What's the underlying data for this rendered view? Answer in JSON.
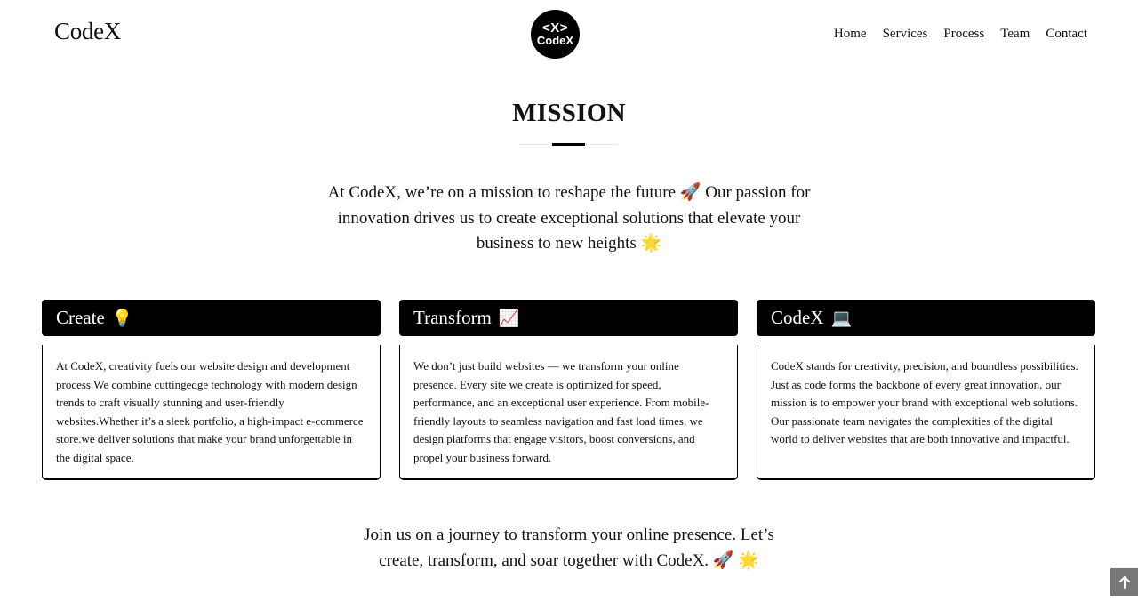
{
  "header": {
    "brand": "CodeX",
    "logo": {
      "glyph": "<X>",
      "word": "CodeX"
    },
    "nav": [
      {
        "label": "Home"
      },
      {
        "label": "Services"
      },
      {
        "label": "Process"
      },
      {
        "label": "Team"
      },
      {
        "label": "Contact"
      }
    ]
  },
  "mission": {
    "title": "MISSION",
    "intro": "At CodeX, we’re on a mission to reshape the future 🚀 Our passion for innovation drives us to create exceptional solutions that elevate your business to new heights 🌟"
  },
  "cards": [
    {
      "title": "Create",
      "emoji": "💡",
      "body": "At CodeX, creativity fuels our website design and development process.We combine cuttingedge technology with modern design trends to craft visually stunning and user-friendly websites.Whether it’s a sleek portfolio, a high-impact e-commerce store.we deliver solutions that make your brand unforgettable in the digital space."
    },
    {
      "title": "Transform",
      "emoji": "📈",
      "body": "We don’t just build websites — we transform your online presence. Every site we create is optimized for speed, performance, and an exceptional user experience. From mobile-friendly layouts to seamless navigation and fast load times, we design platforms that engage visitors, boost conversions, and propel your business forward."
    },
    {
      "title": "CodeX",
      "emoji": "💻",
      "body": "CodeX stands for creativity, precision, and boundless possibilities. Just as code forms the backbone of every great innovation, our mission is to empower your brand with exceptional web solutions. Our passionate team navigates the complexities of the digital world to deliver websites that are both innovative and impactful."
    }
  ],
  "closing": "Join us on a journey to transform your online presence. Let’s create, transform, and soar together with CodeX. 🚀 🌟",
  "icons": {
    "scroll_top": "arrow-up-icon"
  },
  "colors": {
    "card_header": "#000000",
    "scroll_button": "#777777"
  }
}
